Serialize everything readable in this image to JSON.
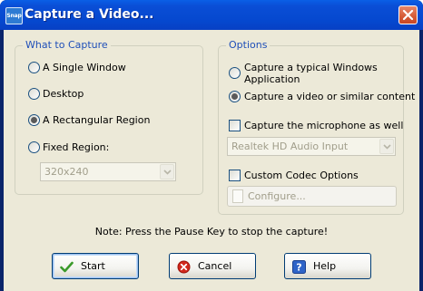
{
  "window": {
    "title": "Capture a Video...",
    "app_icon_text": "Snap"
  },
  "what_to_capture": {
    "title": "What to Capture",
    "options": [
      {
        "label": "A Single Window",
        "selected": false
      },
      {
        "label": "Desktop",
        "selected": false
      },
      {
        "label": "A Rectangular Region",
        "selected": true
      },
      {
        "label": "Fixed Region:",
        "selected": false
      }
    ],
    "fixed_region_value": "320x240"
  },
  "options": {
    "title": "Options",
    "mode_options": [
      {
        "line1": "Capture a typical Windows",
        "line2": "Application",
        "selected": false
      },
      {
        "line1": "Capture a video or similar content",
        "line2": "",
        "selected": true
      }
    ],
    "microphone_label": "Capture the microphone as well",
    "microphone_checked": false,
    "audio_input_value": "Realtek HD Audio Input",
    "codec_label": "Custom Codec Options",
    "codec_checked": false,
    "configure_label": "Configure..."
  },
  "note": "Note: Press the Pause Key to stop the capture!",
  "buttons": {
    "start": "Start",
    "cancel": "Cancel",
    "help": "Help"
  },
  "colors": {
    "titlebar": "#0548cf",
    "group_title": "#1f4fb8",
    "dialog_bg": "#ece9d8"
  }
}
